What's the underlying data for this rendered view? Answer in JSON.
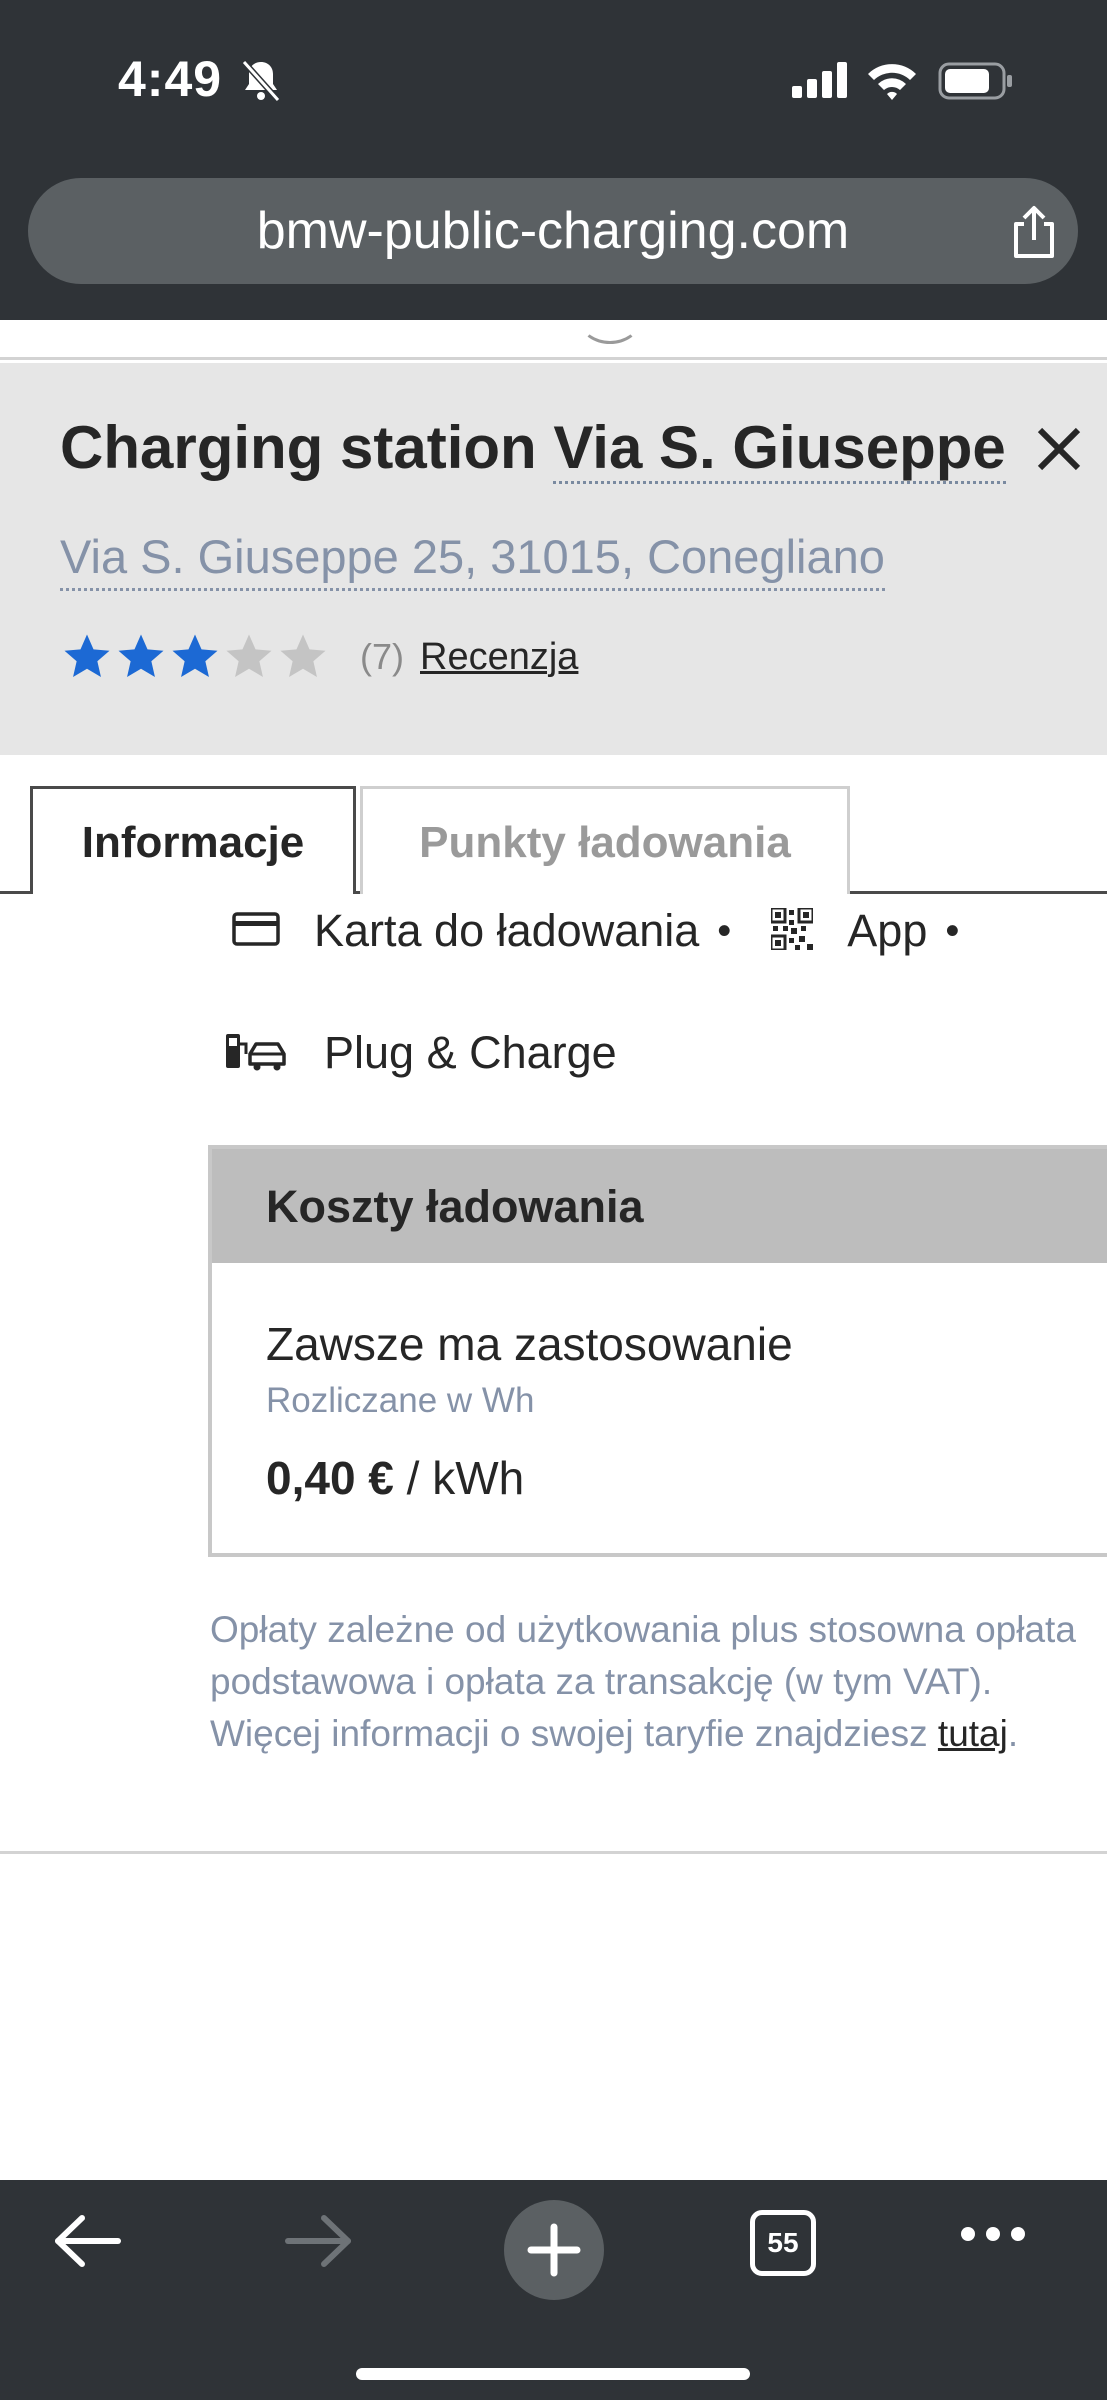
{
  "status_bar": {
    "time": "4:49"
  },
  "browser": {
    "url": "bmw-public-charging.com",
    "tab_count": "55"
  },
  "station": {
    "title_prefix": "Charging station ",
    "title_name": "Via S. Giuseppe",
    "address": "Via S. Giuseppe 25, 31015, Conegliano",
    "rating_stars": 3,
    "rating_max": 5,
    "review_count": "(7)",
    "review_link": "Recenzja"
  },
  "tabs": [
    {
      "label": "Informacje",
      "active": true
    },
    {
      "label": "Punkty ładowania",
      "active": false
    }
  ],
  "payment_methods": {
    "card": "Karta do ładowania",
    "app": "App",
    "plug_charge": "Plug & Charge",
    "separator": "•"
  },
  "costs": {
    "header": "Koszty ładowania",
    "title": "Zawsze ma zastosowanie",
    "subtitle": "Rozliczane w Wh",
    "price_amount": "0,40 €",
    "price_unit": " / kWh"
  },
  "fee_note": {
    "line1": "Opłaty zależne od użytkowania plus stosowna opłata",
    "line2": "podstawowa i opłata za transakcję (w tym VAT).",
    "line3_prefix": "Więcej informacji o swojej taryfie znajdziesz ",
    "link": "tutaj",
    "line3_suffix": "."
  },
  "colors": {
    "chrome": "#2f3337",
    "star_active": "#1c69d4",
    "star_inactive": "#c4c4c4",
    "muted_text": "#8592a8"
  }
}
